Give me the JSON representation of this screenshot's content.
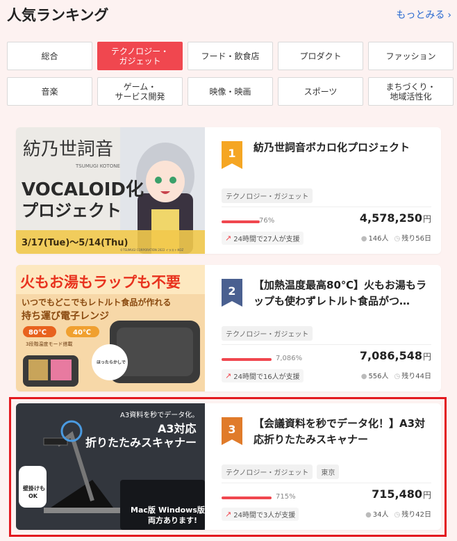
{
  "header": {
    "title": "人気ランキング",
    "more_label": "もっとみる",
    "more_icon": "chevron-right-icon"
  },
  "categories": [
    {
      "label": "総合",
      "active": false
    },
    {
      "label": "テクノロジー・\nガジェット",
      "active": true
    },
    {
      "label": "フード・飲食店",
      "active": false
    },
    {
      "label": "プロダクト",
      "active": false
    },
    {
      "label": "ファッション",
      "active": false
    },
    {
      "label": "音楽",
      "active": false
    },
    {
      "label": "ゲーム・\nサービス開発",
      "active": false
    },
    {
      "label": "映像・映画",
      "active": false
    },
    {
      "label": "スポーツ",
      "active": false
    },
    {
      "label": "まちづくり・\n地域活性化",
      "active": false
    }
  ],
  "projects": [
    {
      "rank": "1",
      "rank_color": "#f5a623",
      "title": "紡乃世詞音ボカロ化プロジェクト",
      "tags": [
        "テクノロジー・ガジェット"
      ],
      "percent": "76%",
      "progress": 0.76,
      "amount": "4,578,250",
      "currency": "円",
      "support_24h": "24時間で27人が支援",
      "supporters": "146人",
      "remaining": "残り56日",
      "thumb": {
        "line1": "紡乃世詞音",
        "line2": "TSUMUGI KOTONE",
        "line3": "VOCALOID化",
        "line4": "プロジェクト",
        "dates": "3/17(Tue)～5/14(Thu)",
        "credit": "©TSUMUGI CORPORATION 2022 イラスト:KOZ"
      }
    },
    {
      "rank": "2",
      "rank_color": "#4a6090",
      "title": "【加熱温度最高80℃】火もお湯もラップも使わずレトルト食品がつ…",
      "tags": [
        "テクノロジー・ガジェット"
      ],
      "percent": "7,086%",
      "progress": 1.0,
      "amount": "7,086,548",
      "currency": "円",
      "support_24h": "24時間で16人が支援",
      "supporters": "556人",
      "remaining": "残り44日",
      "thumb": {
        "line1": "火もお湯もラップも不要",
        "line2": "いつでもどこでもレトルト食品が作れる",
        "line3": "持ち運び電子レンジ",
        "temp_hi": "80℃",
        "temp_lo": "40℃",
        "mode": "3段階温度モード搭載",
        "badge": "ほったらかしで\nホカホカの\nレトルトが完成!!"
      }
    },
    {
      "rank": "3",
      "rank_color": "#e07b2a",
      "title": "【会議資料を秒でデータ化！】A3対応折りたたみスキャナー",
      "tags": [
        "テクノロジー・ガジェット",
        "東京"
      ],
      "percent": "715%",
      "progress": 1.0,
      "amount": "715,480",
      "currency": "円",
      "support_24h": "24時間で3人が支援",
      "supporters": "34人",
      "remaining": "残り42日",
      "thumb": {
        "line1": "A3資料を秒でデータ化。",
        "line2": "A3対応",
        "line3": "折りたたみスキャナー",
        "mac": "Mac版",
        "win": "Windows版",
        "both": "両方あります!",
        "wall": "壁掛けも\nOK"
      }
    }
  ],
  "colors": {
    "accent": "#f0474f",
    "link": "#2a6ad0",
    "background": "#fdf2f1",
    "highlight": "#e3191f"
  }
}
